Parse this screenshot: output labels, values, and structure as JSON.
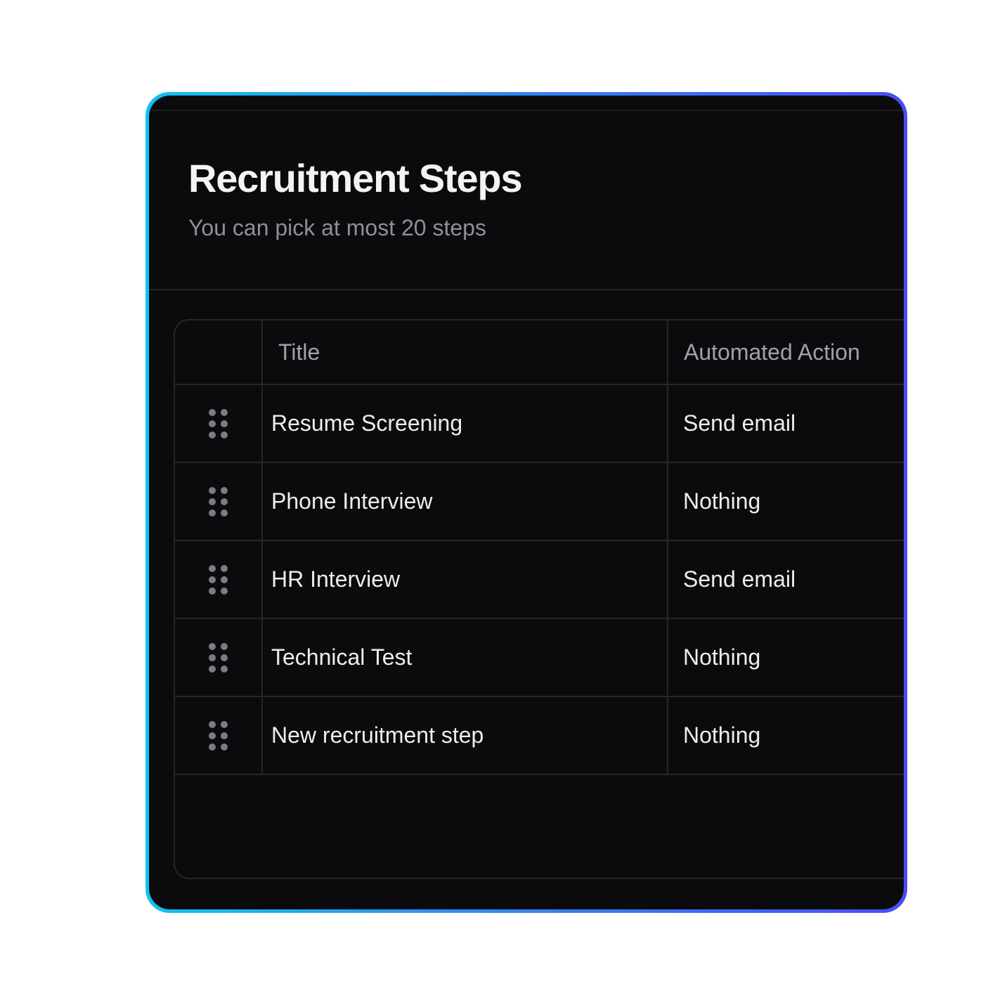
{
  "panel": {
    "title": "Recruitment Steps",
    "subtitle": "You can pick at most 20 steps"
  },
  "table": {
    "columns": {
      "handle": "",
      "title": "Title",
      "action": "Automated Action"
    },
    "rows": [
      {
        "handle_icon": "drag-handle-icon",
        "title": "Resume Screening",
        "action": "Send email"
      },
      {
        "handle_icon": "drag-handle-icon",
        "title": "Phone Interview",
        "action": "Nothing"
      },
      {
        "handle_icon": "drag-handle-icon",
        "title": "HR Interview",
        "action": "Send email"
      },
      {
        "handle_icon": "drag-handle-icon",
        "title": "Technical Test",
        "action": "Nothing"
      },
      {
        "handle_icon": "drag-handle-icon",
        "title": "New recruitment step",
        "action": "Nothing"
      }
    ]
  },
  "colors": {
    "border_gradient_start": "#12c2ee",
    "border_gradient_end": "#4a4cf5",
    "panel_background": "#0b0b0d",
    "page_background": "#ffffff"
  }
}
